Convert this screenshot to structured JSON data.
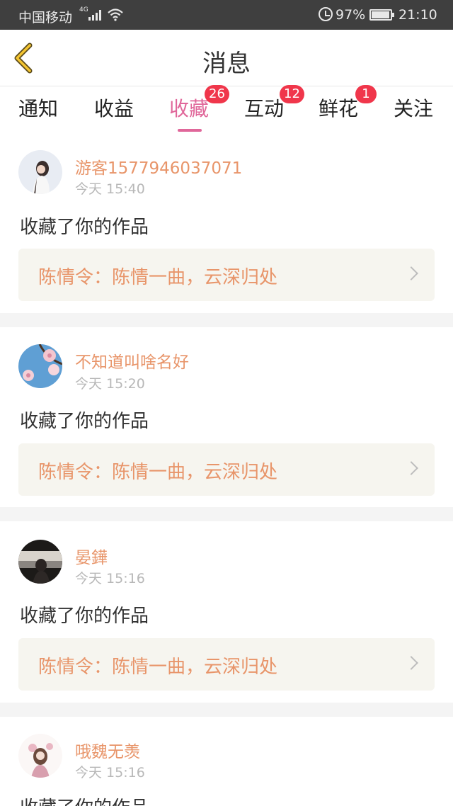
{
  "status_bar": {
    "carrier": "中国移动",
    "network": "4G",
    "battery": "97%",
    "time": "21:10"
  },
  "header": {
    "title": "消息",
    "back_icon": "chevron-left-icon"
  },
  "tabs": [
    {
      "label": "通知",
      "badge": ""
    },
    {
      "label": "收益",
      "badge": ""
    },
    {
      "label": "收藏",
      "badge": "26",
      "active": true
    },
    {
      "label": "互动",
      "badge": "12"
    },
    {
      "label": "鲜花",
      "badge": "1"
    },
    {
      "label": "关注",
      "badge": ""
    }
  ],
  "colors": {
    "accent": "#e0679a",
    "username": "#e8956a",
    "badge": "#f0364b"
  },
  "messages": [
    {
      "user": "游客1577946037071",
      "time": "今天 15:40",
      "action": "收藏了你的作品",
      "work": "陈情令：陈情一曲，云深归处"
    },
    {
      "user": "不知道叫啥名好",
      "time": "今天 15:20",
      "action": "收藏了你的作品",
      "work": "陈情令：陈情一曲，云深归处"
    },
    {
      "user": "晏鏵",
      "time": "今天 15:16",
      "action": "收藏了你的作品",
      "work": "陈情令：陈情一曲，云深归处"
    },
    {
      "user": "哦魏无羡",
      "time": "今天 15:16",
      "action": "收藏了你的作品",
      "work": ""
    }
  ]
}
